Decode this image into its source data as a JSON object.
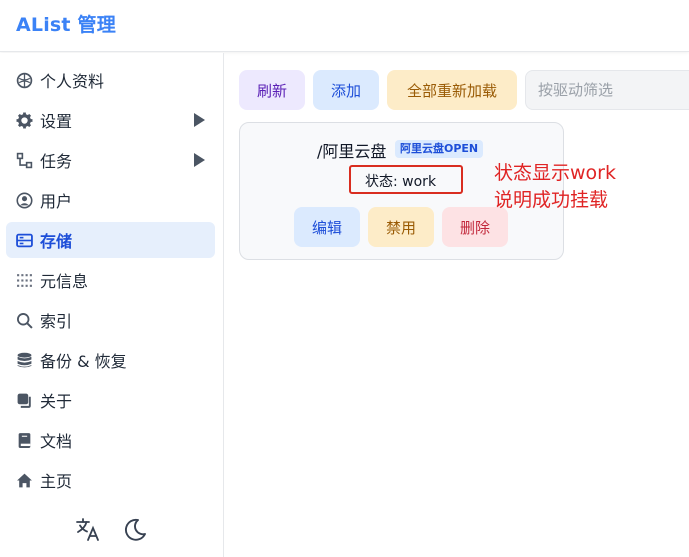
{
  "header": {
    "logo": "AList 管理"
  },
  "sidebar": {
    "items": [
      {
        "label": "个人资料",
        "icon": "profile-icon"
      },
      {
        "label": "设置",
        "icon": "gear-icon"
      },
      {
        "label": "任务",
        "icon": "tasks-icon"
      },
      {
        "label": "用户",
        "icon": "user-icon"
      },
      {
        "label": "存储",
        "icon": "storage-icon"
      },
      {
        "label": "元信息",
        "icon": "meta-icon"
      },
      {
        "label": "索引",
        "icon": "search-icon"
      },
      {
        "label": "备份 & 恢复",
        "icon": "database-icon"
      },
      {
        "label": "关于",
        "icon": "copy-icon"
      },
      {
        "label": "文档",
        "icon": "book-icon"
      },
      {
        "label": "主页",
        "icon": "home-icon"
      }
    ],
    "active": "存储"
  },
  "toolbar": {
    "refresh_label": "刷新",
    "add_label": "添加",
    "reload_label": "全部重新加载",
    "filter_placeholder": "按驱动筛选"
  },
  "storage_card": {
    "mount_path": "/阿里云盘",
    "driver": "阿里云盘OPEN",
    "status": "状态: work",
    "edit_label": "编辑",
    "disable_label": "禁用",
    "delete_label": "删除"
  },
  "annotation": {
    "line1": "状态显示work",
    "line2": "说明成功挂载",
    "color": "#e02424"
  },
  "colors": {
    "accent": "#3b82f6",
    "active_bg": "#e6effc"
  }
}
